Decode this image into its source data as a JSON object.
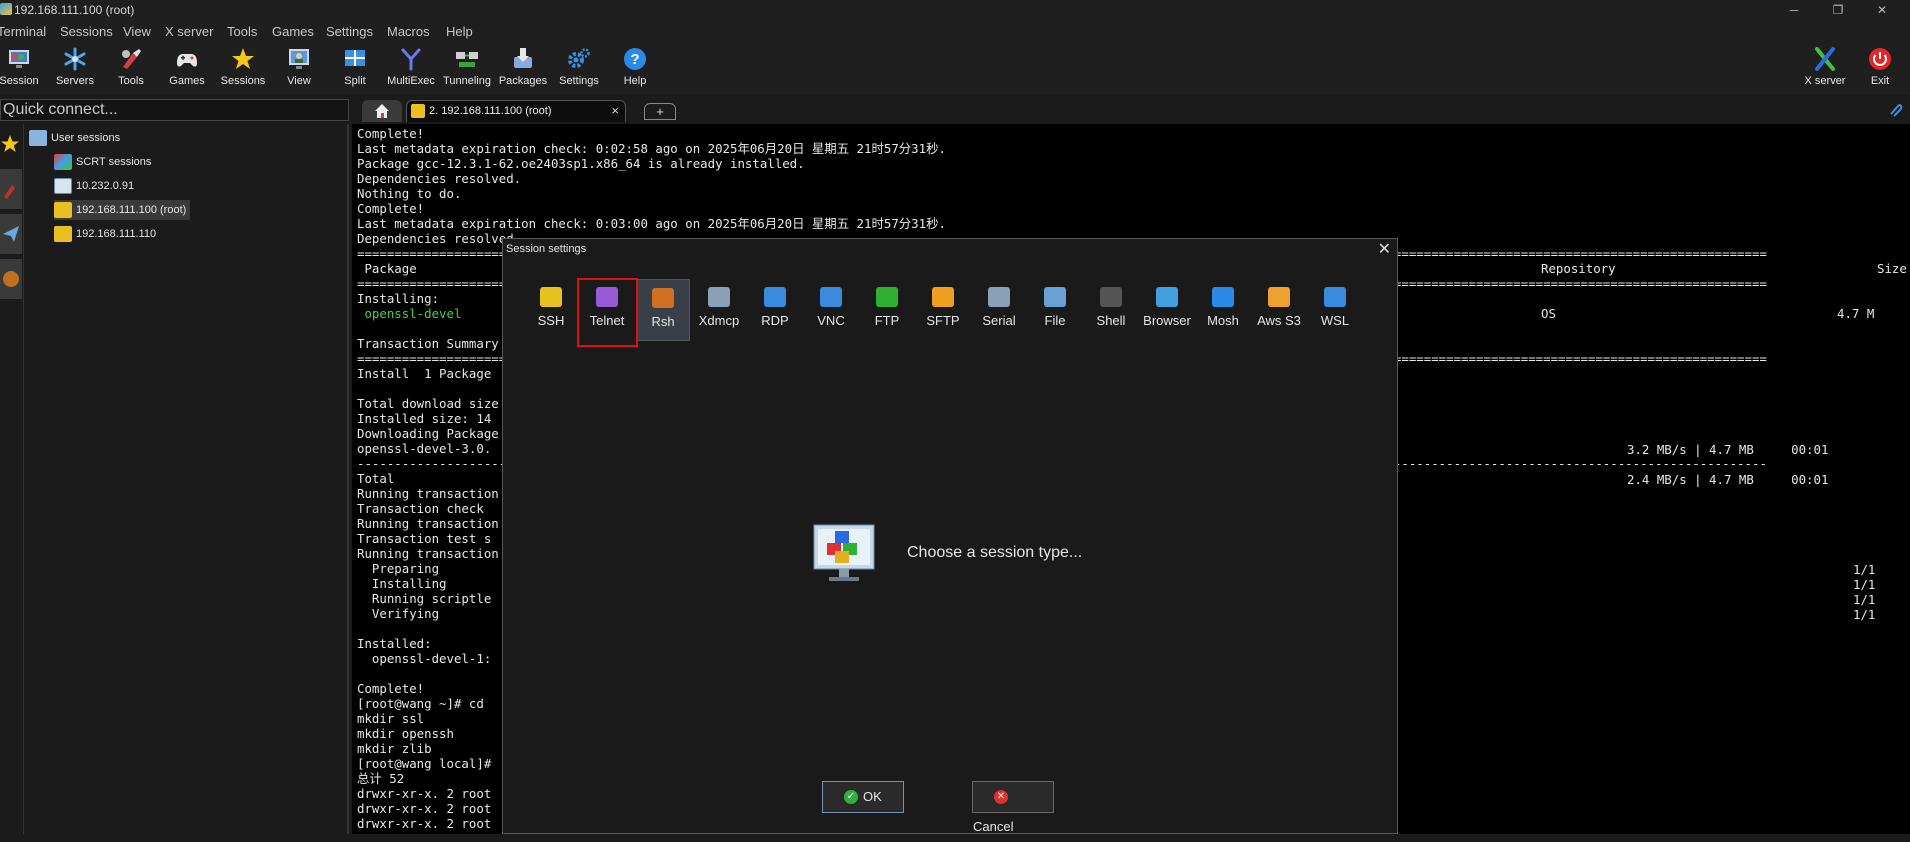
{
  "window": {
    "title": "192.168.111.100 (root)"
  },
  "menu": [
    "Terminal",
    "Sessions",
    "View",
    "X server",
    "Tools",
    "Games",
    "Settings",
    "Macros",
    "Help"
  ],
  "toolbar": {
    "buttons": [
      "Session",
      "Servers",
      "Tools",
      "Games",
      "Sessions",
      "View",
      "Split",
      "MultiExec",
      "Tunneling",
      "Packages",
      "Settings",
      "Help"
    ],
    "right": [
      "X server",
      "Exit"
    ]
  },
  "quick_connect": {
    "placeholder": "Quick connect..."
  },
  "tabs": {
    "active": "2. 192.168.111.100 (root)",
    "close": "×",
    "add": "+"
  },
  "sidebar": {
    "root": "User sessions",
    "items": [
      "SCRT sessions",
      "10.232.0.91",
      "192.168.111.100 (root)",
      "192.168.111.110"
    ]
  },
  "terminal": {
    "lines": [
      "Complete!",
      "Last metadata expiration check: 0:02:58 ago on 2025年06月20日 星期五 21时57分31秒.",
      "Package gcc-12.3.1-62.oe2403sp1.x86_64 is already installed.",
      "Dependencies resolved.",
      "Nothing to do.",
      "Complete!",
      "Last metadata expiration check: 0:03:00 ago on 2025年06月20日 星期五 21时57分31秒.",
      "Dependencies resolved.",
      "=============================================================================================================================================================================================",
      " Package",
      "=============================================================================================================================================================================================",
      "Installing:",
      " openssl-devel",
      "",
      "Transaction Summary",
      "=============================================================================================================================================================================================",
      "Install  1 Package",
      "",
      "Total download size",
      "Installed size: 14",
      "Downloading Package",
      "openssl-devel-3.0.",
      "---------------------------------------------------------------------------------------------------------------------------------------------------------------------------------------------",
      "Total",
      "Running transaction",
      "Transaction check",
      "Running transaction",
      "Transaction test s",
      "Running transaction",
      "  Preparing",
      "  Installing",
      "  Running scriptle",
      "  Verifying",
      "",
      "Installed:",
      "  openssl-devel-1:",
      "",
      "Complete!",
      "[root@wang ~]# cd",
      "mkdir ssl",
      "mkdir openssh",
      "mkdir zlib",
      "[root@wang local]#",
      "总计 52",
      "drwxr-xr-x. 2 root",
      "drwxr-xr-x. 2 root",
      "drwxr-xr-x. 2 root"
    ],
    "right_col": {
      "repository_header": "Repository",
      "size_header": "Size",
      "repo": "OS",
      "size": "4.7 M",
      "dl1": "3.2 MB/s | 4.7 MB     00:01",
      "dl2": "2.4 MB/s | 4.7 MB     00:01",
      "progress": "1/1"
    }
  },
  "dialog": {
    "title": "Session settings",
    "close": "✕",
    "session_types": [
      "SSH",
      "Telnet",
      "Rsh",
      "Xdmcp",
      "RDP",
      "VNC",
      "FTP",
      "SFTP",
      "Serial",
      "File",
      "Shell",
      "Browser",
      "Mosh",
      "Aws S3",
      "WSL"
    ],
    "selected": "Rsh",
    "highlighted": "Telnet",
    "prompt": "Choose a session type...",
    "ok_label": "OK",
    "cancel_label": "Cancel"
  },
  "colors": {
    "highlight": "#e01010",
    "terminal_bg": "#000000",
    "green_text": "#4ad24a"
  }
}
